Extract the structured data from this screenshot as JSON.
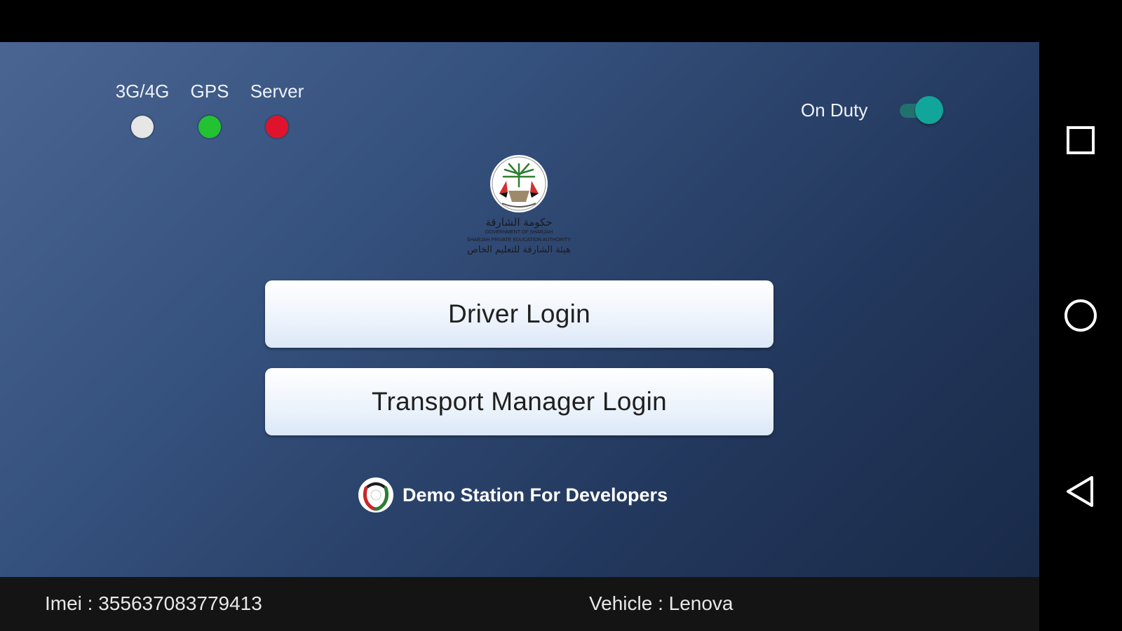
{
  "status": {
    "indicators": [
      {
        "label": "3G/4G",
        "color": "#e6e6e6"
      },
      {
        "label": "GPS",
        "color": "#22c233"
      },
      {
        "label": "Server",
        "color": "#e0132c"
      }
    ],
    "on_duty": {
      "label": "On Duty",
      "enabled": true,
      "accent": "#12a59a"
    }
  },
  "logo": {
    "arabic_line1": "حكومة الشارقة",
    "english_line1": "GOVERNMENT OF SHARJAH",
    "english_line2": "SHARJAH PRIVATE EDUCATION AUTHORITY",
    "arabic_line2": "هيئة الشارقة للتعليم الخاص"
  },
  "buttons": {
    "driver_login": "Driver Login",
    "manager_login": "Transport Manager Login"
  },
  "station": {
    "name": "Demo Station For Developers",
    "icon": "station-logo-icon"
  },
  "footer": {
    "imei": "Imei :  355637083779413",
    "vehicle": "Vehicle :  Lenova"
  },
  "navbar": {
    "icons": [
      "recent-apps-icon",
      "home-icon",
      "back-icon"
    ]
  }
}
